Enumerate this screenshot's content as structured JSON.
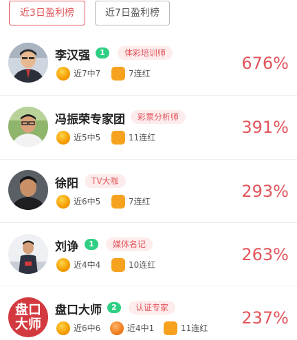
{
  "tabs": [
    {
      "label": "近3日盈利榜",
      "active": true
    },
    {
      "label": "近7日盈利榜",
      "active": false
    }
  ],
  "accent_color": "#e2555b",
  "level_badge_color": "#2fcf83",
  "experts": [
    {
      "name": "李汉强",
      "level": "1",
      "tag": "体彩培训师",
      "record": "近7中7",
      "streak": "7连红",
      "profit": "676%",
      "avatar": "photo-man-suit"
    },
    {
      "name": "冯振荣专家团",
      "tag": "彩票分析师",
      "record": "近5中5",
      "streak": "11连红",
      "profit": "391%",
      "avatar": "photo-man-glasses"
    },
    {
      "name": "徐阳",
      "tag": "TV大咖",
      "record": "近6中5",
      "streak": "7连红",
      "profit": "293%",
      "avatar": "photo-man-portrait"
    },
    {
      "name": "刘诤",
      "level": "1",
      "tag": "媒体名记",
      "record": "近4中4",
      "streak": "10连红",
      "profit": "263%",
      "avatar": "photo-man-standing"
    },
    {
      "name": "盘口大师",
      "level": "2",
      "tag": "认证专家",
      "record": "近6中6",
      "record2": "近4中1",
      "streak": "11连红",
      "profit": "237%",
      "avatar_text": "盘口大师"
    }
  ]
}
